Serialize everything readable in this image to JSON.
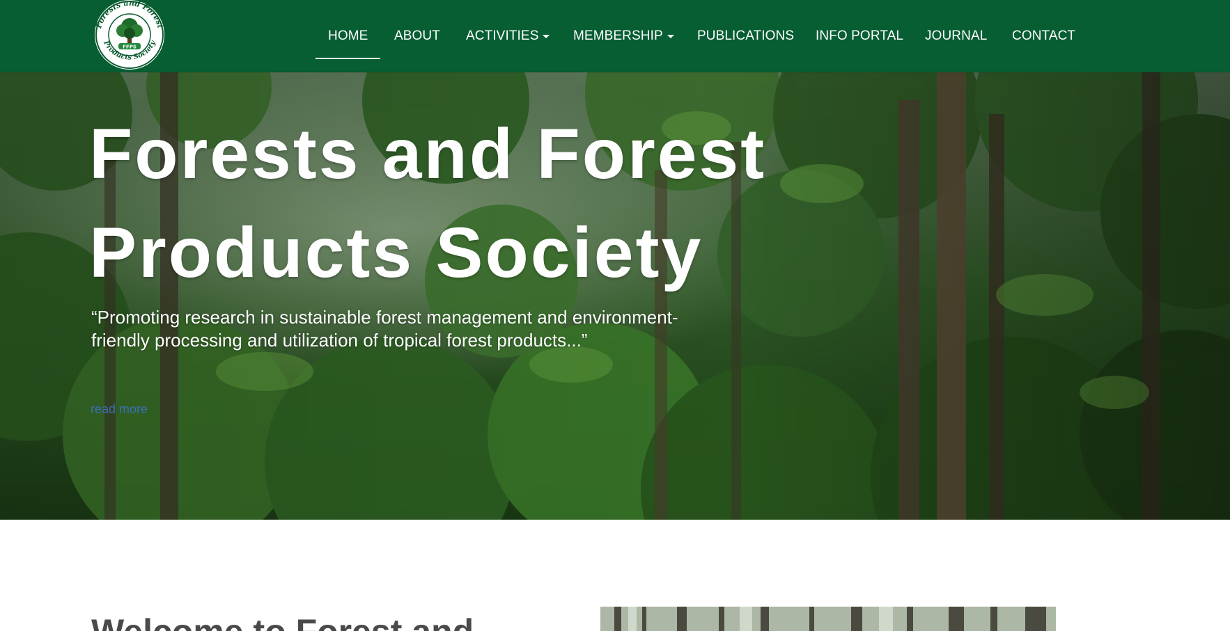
{
  "logo": {
    "text_top": "Forests and Forest",
    "text_bottom": "Products Society",
    "badge": "FFPS"
  },
  "nav": {
    "items": [
      {
        "label": "HOME",
        "dropdown": false,
        "active": true
      },
      {
        "label": "ABOUT",
        "dropdown": false,
        "active": false
      },
      {
        "label": "ACTIVITIES",
        "dropdown": true,
        "active": false
      },
      {
        "label": "MEMBERSHIP",
        "dropdown": true,
        "active": false
      },
      {
        "label": "PUBLICATIONS",
        "dropdown": false,
        "active": false
      },
      {
        "label": "INFO PORTAL",
        "dropdown": false,
        "active": false
      },
      {
        "label": "JOURNAL",
        "dropdown": false,
        "active": false
      },
      {
        "label": "CONTACT",
        "dropdown": false,
        "active": false
      }
    ]
  },
  "hero": {
    "title_line1": "Forests and Forest",
    "title_line2": "Products Society",
    "quote_line1": "“Promoting research in sustainable forest management and environment-",
    "quote_line2": "friendly processing and utilization of tropical forest products...”",
    "read_more": "read more"
  },
  "welcome": {
    "title": "Welcome to Forest and"
  },
  "colors": {
    "nav_bg": "#075e33",
    "nav_text": "#ffffff",
    "link": "#3b6fb6",
    "heading": "#4a4a4a"
  },
  "icons": {
    "dropdown": "caret-down-icon"
  }
}
